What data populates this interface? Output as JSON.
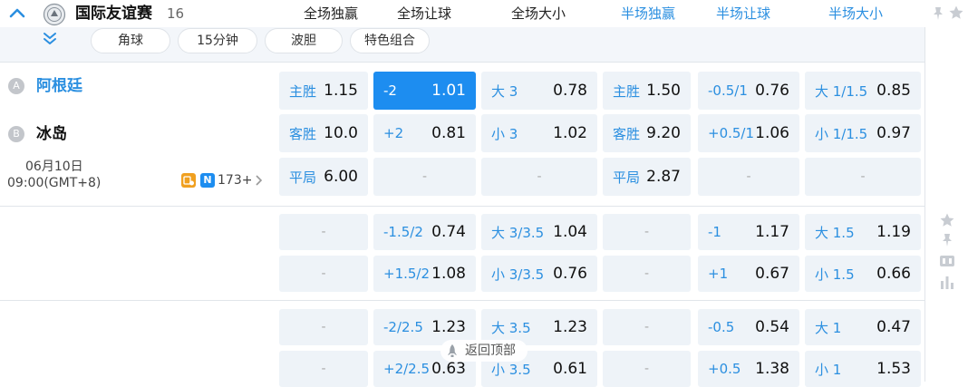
{
  "league": {
    "name": "国际友谊赛",
    "count": "16"
  },
  "header_columns": [
    {
      "label": "全场独赢",
      "color": "#222222"
    },
    {
      "label": "全场让球",
      "color": "#222222"
    },
    {
      "label": "全场大小",
      "color": "#222222"
    },
    {
      "label": "半场独赢",
      "color": "#2b8fe0"
    },
    {
      "label": "半场让球",
      "color": "#2b8fe0"
    },
    {
      "label": "半场大小",
      "color": "#2b8fe0"
    }
  ],
  "filters": [
    "角球",
    "15分钟",
    "波胆",
    "特色组合"
  ],
  "match": {
    "home": {
      "badge": "A",
      "name": "阿根廷"
    },
    "away": {
      "badge": "B",
      "name": "冰岛"
    },
    "date": "06月10日",
    "time": "09:00(GMT+8)",
    "live_badge": "N",
    "more_count": "173+"
  },
  "odds_rows": [
    [
      {
        "label": "主胜",
        "value": "1.15"
      },
      {
        "label": "-2",
        "value": "1.01",
        "selected": true
      },
      {
        "label": "大 3",
        "value": "0.78"
      },
      {
        "label": "主胜",
        "value": "1.50"
      },
      {
        "label": "-0.5/1",
        "value": "0.76"
      },
      {
        "label": "大 1/1.5",
        "value": "0.85"
      }
    ],
    [
      {
        "label": "客胜",
        "value": "10.0"
      },
      {
        "label": "+2",
        "value": "0.81"
      },
      {
        "label": "小 3",
        "value": "1.02"
      },
      {
        "label": "客胜",
        "value": "9.20"
      },
      {
        "label": "+0.5/1",
        "value": "1.06"
      },
      {
        "label": "小 1/1.5",
        "value": "0.97"
      }
    ],
    [
      {
        "label": "平局",
        "value": "6.00"
      },
      {
        "empty": "-"
      },
      {
        "empty": "-"
      },
      {
        "label": "平局",
        "value": "2.87"
      },
      {
        "empty": "-"
      },
      {
        "empty": "-"
      }
    ],
    [
      {
        "empty": "-"
      },
      {
        "label": "-1.5/2",
        "value": "0.74"
      },
      {
        "label": "大 3/3.5",
        "value": "1.04"
      },
      {
        "empty": "-"
      },
      {
        "label": "-1",
        "value": "1.17"
      },
      {
        "label": "大 1.5",
        "value": "1.19"
      }
    ],
    [
      {
        "empty": "-"
      },
      {
        "label": "+1.5/2",
        "value": "1.08"
      },
      {
        "label": "小 3/3.5",
        "value": "0.76"
      },
      {
        "empty": "-"
      },
      {
        "label": "+1",
        "value": "0.67"
      },
      {
        "label": "小 1.5",
        "value": "0.66"
      }
    ],
    [
      {
        "empty": "-"
      },
      {
        "label": "-2/2.5",
        "value": "1.23"
      },
      {
        "label": "大 3.5",
        "value": "1.23"
      },
      {
        "empty": "-"
      },
      {
        "label": "-0.5",
        "value": "0.54"
      },
      {
        "label": "大 1",
        "value": "0.47"
      }
    ],
    [
      {
        "empty": "-"
      },
      {
        "label": "+2/2.5",
        "value": "0.63"
      },
      {
        "label": "小 3.5",
        "value": "0.61"
      },
      {
        "empty": "-"
      },
      {
        "label": "+0.5",
        "value": "1.38"
      },
      {
        "label": "小 1",
        "value": "1.53"
      }
    ]
  ],
  "back_to_top": "返回顶部",
  "icons": {
    "collapse": "chevron-up-icon",
    "expand": "double-chevron-down-icon",
    "league": "league-emblem-icon",
    "star": "star-icon",
    "pin": "pin-icon",
    "score": "scoreboard-icon",
    "stats": "bar-chart-icon"
  },
  "colors": {
    "accent": "#2b8fe0",
    "selected": "#1d8df0",
    "cell_bg": "#eef3f8",
    "badge_orange": "#f0a020"
  }
}
